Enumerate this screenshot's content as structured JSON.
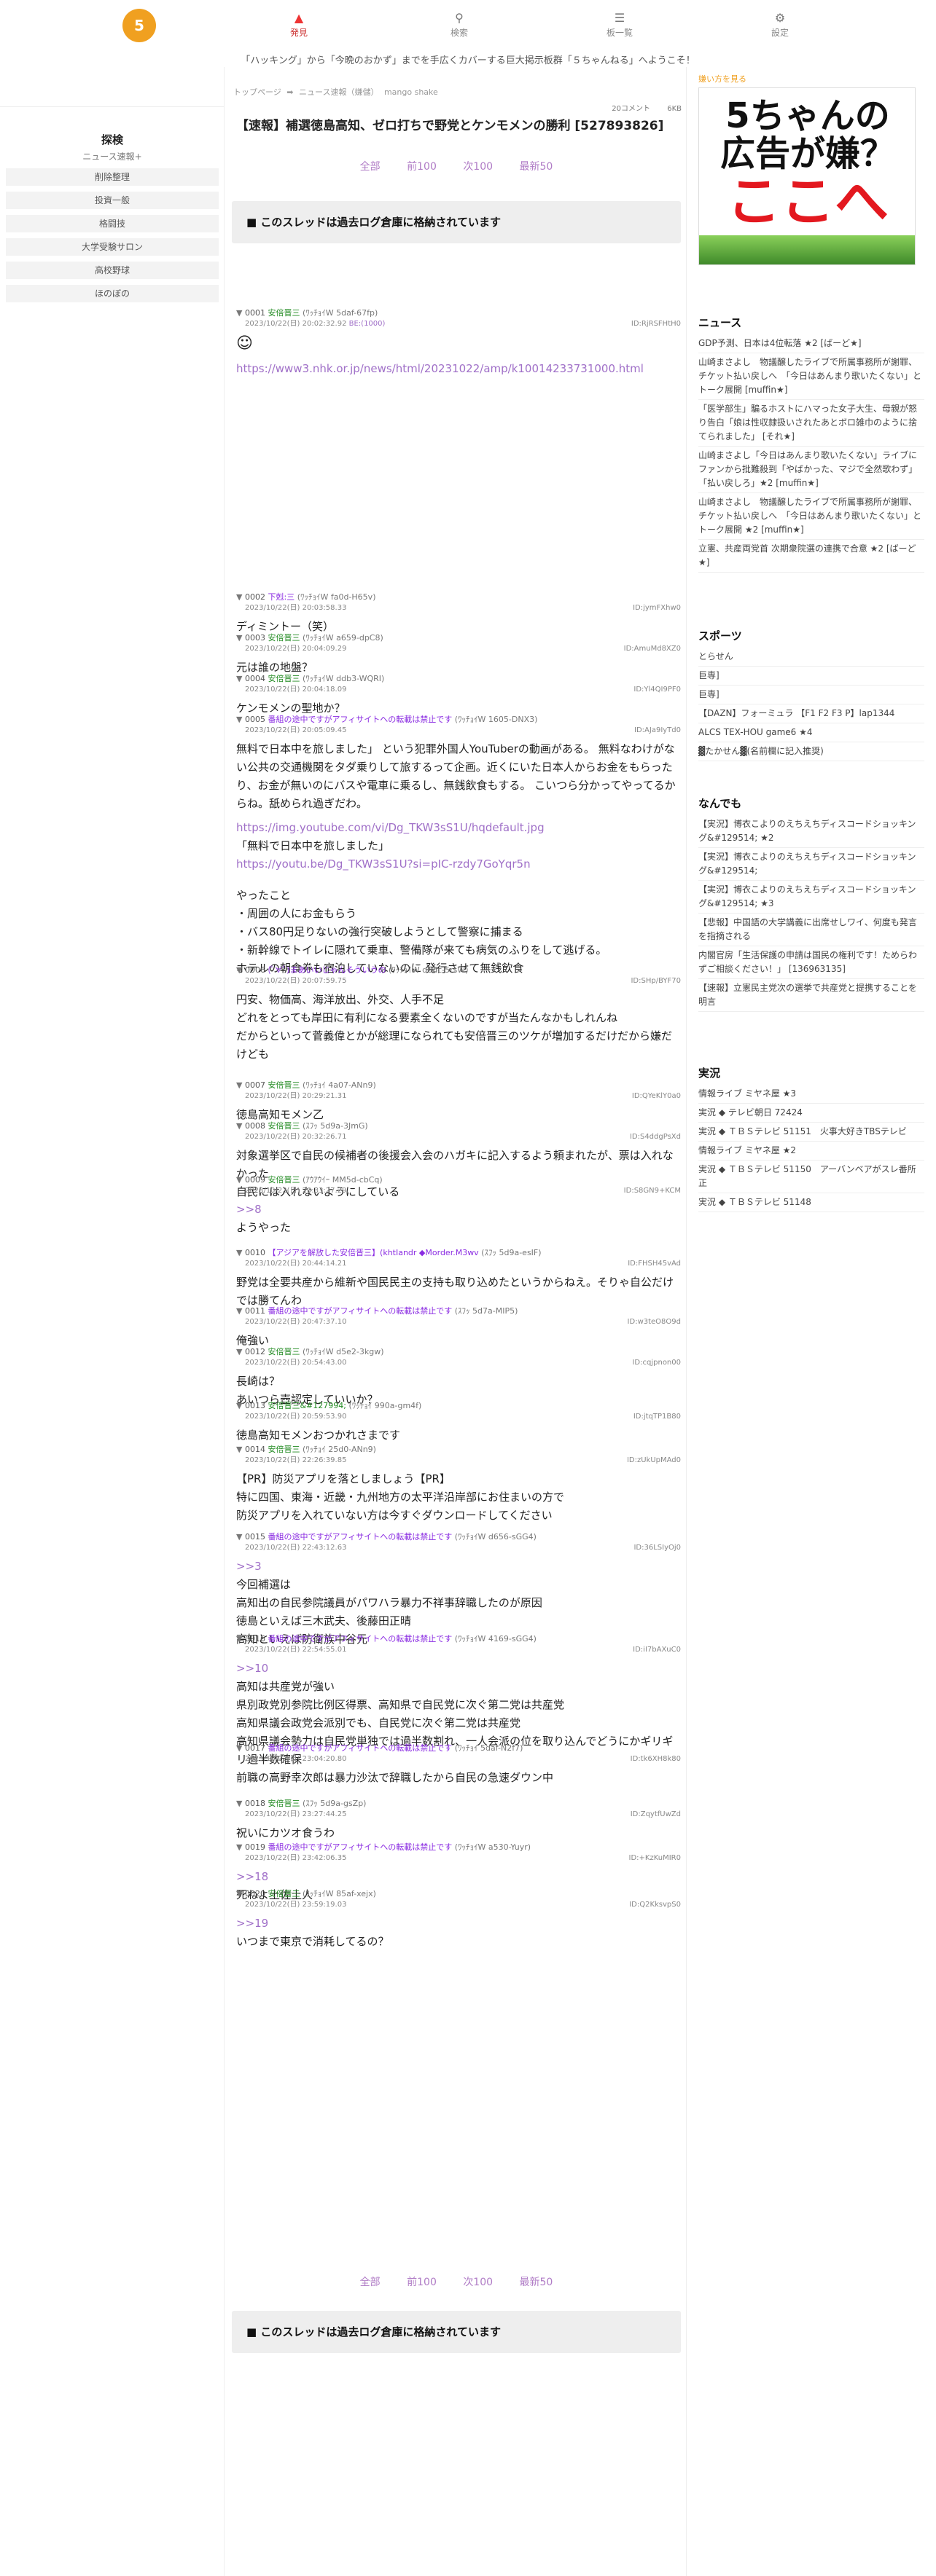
{
  "nav": {
    "logo_text": "5",
    "post_label": "発見",
    "search_label": "検索",
    "list_label": "板一覧",
    "settings_label": "設定"
  },
  "banner": "「ハッキング」から「今晩のおかず」までを手広くカバーする巨大掲示板群「５ちゃんねる」へようこそ！",
  "left_nav": {
    "title": "探検",
    "subtitle": "ニュース速報+",
    "items": [
      "削除整理",
      "投資一般",
      "格闘技",
      "大学受験サロン",
      "高校野球",
      "ほのぼの"
    ]
  },
  "breadcrumb": [
    "トップページ",
    "➡",
    "ニュース速報（嫌儲）",
    "mango shake"
  ],
  "thread": {
    "res_count": "20コメント",
    "size": "6KB",
    "title": "【速報】補選徳島高知、ゼロ打ちで野党とケンモメンの勝利 [527893826]",
    "pager": [
      "全部",
      "前100",
      "次100",
      "最新50"
    ],
    "archive_notice": "■ このスレッドは過去ログ倉庫に格納されています"
  },
  "posts": [
    {
      "num": "0001",
      "name": "安倍晋三",
      "trip": "(ﾜｯﾁｮｲW 5daf-67fp)",
      "date": "2023/10/22(日) 20:02:32.92",
      "be": "BE:(1000)",
      "id": "ID:RjRSFHtH0",
      "body": "",
      "link": "https://www3.nhk.or.jp/news/html/20231022/amp/k10014233731000.html"
    },
    {
      "num": "0002",
      "name": "下剋:三",
      "trip": "(ﾜｯﾁｮｲW fa0d-H65v)",
      "date": "2023/10/22(日) 20:03:58.33",
      "id": "ID:jymFXhw0",
      "body": "ディミントー（笑）"
    },
    {
      "num": "0003",
      "name": "安倍晋三",
      "trip": "(ﾜｯﾁｮｲW a659-dpC8)",
      "date": "2023/10/22(日) 20:04:09.29",
      "id": "ID:AmuMd8XZ0",
      "body": "元は誰の地盤？"
    },
    {
      "num": "0004",
      "name": "安倍晋三",
      "trip": "(ﾜｯﾁｮｲW ddb3-WQRI)",
      "date": "2023/10/22(日) 20:04:18.09",
      "id": "ID:Yl4QI9PF0",
      "body": "ケンモメンの聖地か？"
    },
    {
      "num": "0005",
      "name": "番組の途中ですがアフィサイトへの転載は禁止です",
      "trip": "(ﾜｯﾁｮｲW 1605-DNX3)",
      "date": "2023/10/22(日) 20:05:09.45",
      "id": "ID:AJa9IyTd0",
      "body": "無料で日本中を旅しました」 という犯罪外国人YouTuberの動画がある。 無料なわけがない公共の交通機関をタダ乗りして旅するって企画。近くにいた日本人からお金をもらったり、お金が無いのにバスや電車に乗るし、無銭飲食もする。 こいつら分かってやってるからね。舐められ過ぎだわ。",
      "link": "https://img.youtube.com/vi/Dg_TKW3sS1U/hqdefault.jpg",
      "body2": "「無料で日本中を旅しました」",
      "link2": "https://youtu.be/Dg_TKW3sS1U?si=pIC-rzdy7GoYqr5n",
      "body3": "やったこと\n・周囲の人にお金もらう\n・バス80円足りないの強行突破しようとして警察に捕まる\n・新幹線でトイレに隠れて乗車、警備隊が来ても病気のふりをして逃げる。\nホテルの朝食券も宿泊していないのに 発行させて無銭飲食"
    },
    {
      "num": "0006",
      "name": "(ﾟ∀ﾟ)まあいいじゃんそういうの",
      "trip": "(ﾜｯﾁｮｲW d6dc-5rsW)",
      "date": "2023/10/22(日) 20:07:59.75",
      "id": "ID:SHp/BYF70",
      "body": "円安、物価高、海洋放出、外交、人手不足\nどれをとっても岸田に有利になる要素全くないのですが当たんなかもしれんね\nだからといって菅義偉とかが総理になられても安倍晋三のツケが増加するだけだから嫌だけども"
    },
    {
      "num": "0007",
      "name": "安倍晋三",
      "trip": "(ﾜｯﾁｮｲ 4a07-ANn9)",
      "date": "2023/10/22(日) 20:29:21.31",
      "id": "ID:QYeKlY0a0",
      "body": "徳島高知モメン乙"
    },
    {
      "num": "0008",
      "name": "安倍晋三",
      "trip": "(ｽﾌｯ 5d9a-3JmG)",
      "date": "2023/10/22(日) 20:32:26.71",
      "id": "ID:S4ddgPsXd",
      "body": "対象選挙区で自民の候補者の後援会入会のハガキに記入するよう頼まれたが、票は入れなかった\n自民には入れないようにしている"
    },
    {
      "num": "0009",
      "name": "安倍晋三",
      "trip": "(ｱｳｱｳｲｰ MM5d-cbCq)",
      "date": "2023/10/22(日) 20:33:27.29",
      "id": "ID:S8GN9+KCM",
      "body": "",
      "anchor": ">>8",
      "body2": "ようやった"
    },
    {
      "num": "0010",
      "name": "【アジアを解放した安倍晋三】(khtIandr ◆Morder.M3wv",
      "trip": "(ｽﾌｯ 5d9a-esIF)",
      "date": "2023/10/22(日) 20:44:14.21",
      "id": "ID:FHSH45vAd",
      "body": "野党は全要共産から維新や国民民主の支持も取り込めたというからねえ。そりゃ自公だけでは勝てんわ"
    },
    {
      "num": "0011",
      "name": "番組の途中ですがアフィサイトへの転載は禁止です",
      "trip": "(ｽﾌｯ 5d7a-MIP5)",
      "date": "2023/10/22(日) 20:47:37.10",
      "id": "ID:w3teO8O9d",
      "body": "俺強い"
    },
    {
      "num": "0012",
      "name": "安倍晋三",
      "trip": "(ﾜｯﾁｮｲW d5e2-3kgw)",
      "date": "2023/10/22(日) 20:54:43.00",
      "id": "ID:cqjpnon00",
      "body": "長崎は？\nあいつら壺認定していいか？"
    },
    {
      "num": "0013",
      "name": "安倍晋三&#127994;",
      "trip": "(ﾜｯﾁｮｲ 990a-gm4f)",
      "date": "2023/10/22(日) 20:59:53.90",
      "id": "ID:jtqTP1B80",
      "body": "徳島高知モメンおつかれさまです"
    },
    {
      "num": "0014",
      "name": "安倍晋三",
      "trip": "(ﾜｯﾁｮｲ 25d0-ANn9)",
      "date": "2023/10/22(日) 22:26:39.85",
      "id": "ID:zUkUpMAd0",
      "body": "【PR】防災アプリを落としましょう【PR】\n特に四国、東海・近畿・九州地方の太平洋沿岸部にお住まいの方で\n防災アプリを入れていない方は今すぐダウンロードしてください"
    },
    {
      "num": "0015",
      "name": "番組の途中ですがアフィサイトへの転載は禁止です",
      "trip": "(ﾜｯﾁｮｲW d656-sGG4)",
      "date": "2023/10/22(日) 22:43:12.63",
      "id": "ID:36LSIyOj0",
      "anchor": ">>3",
      "body": "今回補選は\n高知出の自民参院議員がパワハラ暴力不祥事辞職したのが原因\n徳島といえば三木武夫、後藤田正晴\n高知といえば防衛族中谷元"
    },
    {
      "num": "0016",
      "name": "番組の途中ですがアフィサイトへの転載は禁止です",
      "trip": "(ﾜｯﾁｮｲW 4169-sGG4)",
      "date": "2023/10/22(日) 22:54:55.01",
      "id": "ID:iI7bAXuC0",
      "anchor": ">>10",
      "body": "高知は共産党が強い\n県別政党別参院比例区得票、高知県で自民党に次ぐ第二党は共産党\n高知県議会政党会派別でも、自民党に次ぐ第二党は共産党\n高知県議会勢力は自民党単独では過半数割れ、一人会派の位を取り込んでどうにかギリギリ過半数確保"
    },
    {
      "num": "0017",
      "name": "番組の途中ですがアフィサイトへの転載は禁止です",
      "trip": "(ﾜｯﾁｮｲ 5daf-N2f7)",
      "date": "2023/10/22(日) 23:04:20.80",
      "id": "ID:tk6XH8k80",
      "body": "前職の高野幸次郎は暴力沙汰で辞職したから自民の急速ダウン中"
    },
    {
      "num": "0018",
      "name": "安倍晋三",
      "trip": "(ｽﾌｯ 5d9a-gsZp)",
      "date": "2023/10/22(日) 23:27:44.25",
      "id": "ID:ZqytfUwZd",
      "body": "祝いにカツオ食うわ"
    },
    {
      "num": "0019",
      "name": "番組の途中ですがアフィサイトへの転載は禁止です",
      "trip": "(ﾜｯﾁｮｲW a530-Yuyr)",
      "date": "2023/10/22(日) 23:42:06.35",
      "id": "ID:+KzKuMIR0",
      "anchor": ">>18",
      "body": "死ねよ土佐土人"
    },
    {
      "num": "0020",
      "name": "安倍晋三",
      "trip": "(ﾜｯﾁｮｲW 85af-xejx)",
      "date": "2023/10/22(日) 23:59:19.03",
      "id": "ID:Q2KksvpS0",
      "anchor": ">>19",
      "body": "いつまで東京で消耗してるの？"
    }
  ],
  "right": {
    "ad_link": "嫌い方を見る",
    "ad_line1": "5ちゃんの",
    "ad_line2": "広告が嫌？",
    "ad_line3": "ここへ",
    "news_title": "ニュース",
    "news_items": [
      "GDP予測、日本は4位転落 ★2 [ばーど★]",
      "山崎まさよし　物議醸したライブで所属事務所が謝罪、チケット払い戻しへ　「今日はあんまり歌いたくない」とトーク展開 [muffin★]",
      "「医学部生」騙るホストにハマった女子大生、母親が怒り告白「娘は性収隷扱いされたあとボロ雑巾のように捨てられました」 [それ★]",
      "山崎まさよし「今日はあんまり歌いたくない」ライブにファンから批難殺到「やばかった、マジで全然歌わず」「払い戻しろ」★2 [muffin★]",
      "山崎まさよし　物議醸したライブで所属事務所が謝罪、チケット払い戻しへ　「今日はあんまり歌いたくない」とトーク展開 ★2 [muffin★]",
      "立憲、共産両党首 次期衆院選の連携で合意 ★2 [ばーど★]"
    ],
    "sports_title": "スポーツ",
    "sports_items": [
      "とらせん",
      "巨専]",
      "巨専]",
      "【DAZN】フォーミュラ 【F1 F2 F3 P】lap1344",
      "ALCS TEX-HOU game6 ★4",
      "▓たかせん▓(名前欄に記入推奨)"
    ],
    "nanj_title": "なんでも",
    "nanj_items": [
      "【実況】博衣こよりのえちえちディスコードショッキング&#129514; ★2",
      "【実況】博衣こよりのえちえちディスコードショッキング&#129514;",
      "【実況】博衣こよりのえちえちディスコードショッキング&#129514; ★3",
      "【悲報】中国語の大学講義に出席せしワイ、何度も発言を指摘される",
      "内閣官房「生活保護の申請は国民の権利です！ためらわずご相談ください！」 [136963135]",
      "【速報】立憲民主党次の選挙で共産党と提携することを明言"
    ],
    "live_title": "実況",
    "live_items": [
      "情報ライブ ミヤネ屋 ★3",
      "実況 ◆ テレビ朝日 72424",
      "実況 ◆ ＴＢＳテレビ 51151　火事大好きTBSテレビ",
      "情報ライブ ミヤネ屋 ★2",
      "実況 ◆ ＴＢＳテレビ 51150　アーバンベアがスレ番所正",
      "実況 ◆ ＴＢＳテレビ 51148"
    ]
  }
}
